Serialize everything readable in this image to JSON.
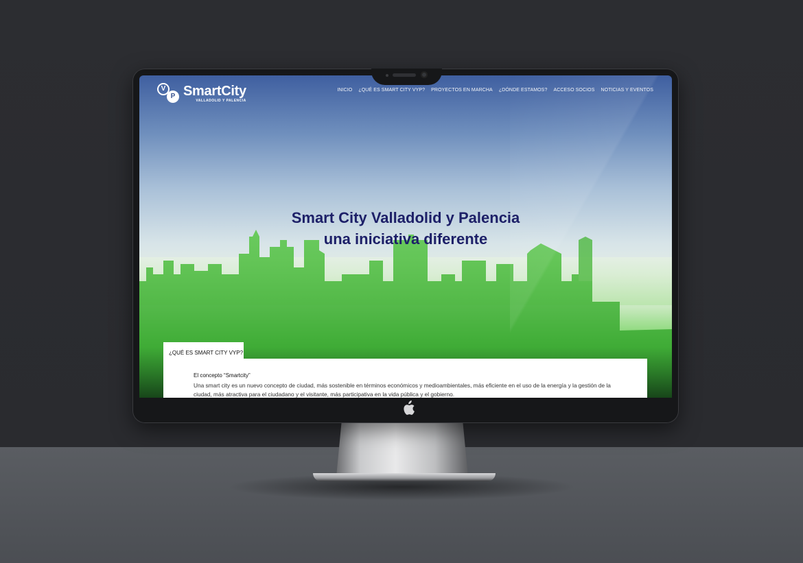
{
  "site": {
    "logo_title": "SmartCity",
    "logo_subtitle": "VALLADOLID Y PALENCIA",
    "logo_letter_1": "V",
    "logo_letter_2": "P"
  },
  "nav": {
    "items": [
      {
        "label": "INICIO"
      },
      {
        "label": "¿QUÉ ES SMART CITY VYP?"
      },
      {
        "label": "PROYECTOS EN MARCHA"
      },
      {
        "label": "¿DÓNDE ESTAMOS?"
      },
      {
        "label": "ACCESO SOCIOS"
      },
      {
        "label": "NOTICIAS Y EVENTOS"
      }
    ]
  },
  "hero": {
    "line1": "Smart City Valladolid y Palencia",
    "line2": "una iniciativa diferente"
  },
  "section": {
    "tab_label": "¿QUÉ ES SMART CITY VYP?",
    "concept_title": "El concepto “Smartcity”",
    "concept_body": "Una smart city es un nuevo concepto de ciudad, más sostenible en términos económicos y medioambientales, más eficiente en el uso de la energía y la gestión de la ciudad, más atractiva para el ciudadano y el visitante, más participativa en la vida pública y el gobierno."
  },
  "icons": [
    "apple-icon",
    "camera-icon"
  ],
  "colors": {
    "hero_title": "#1d2068",
    "backdrop": "#2b2c30",
    "desk": "#55585d"
  }
}
